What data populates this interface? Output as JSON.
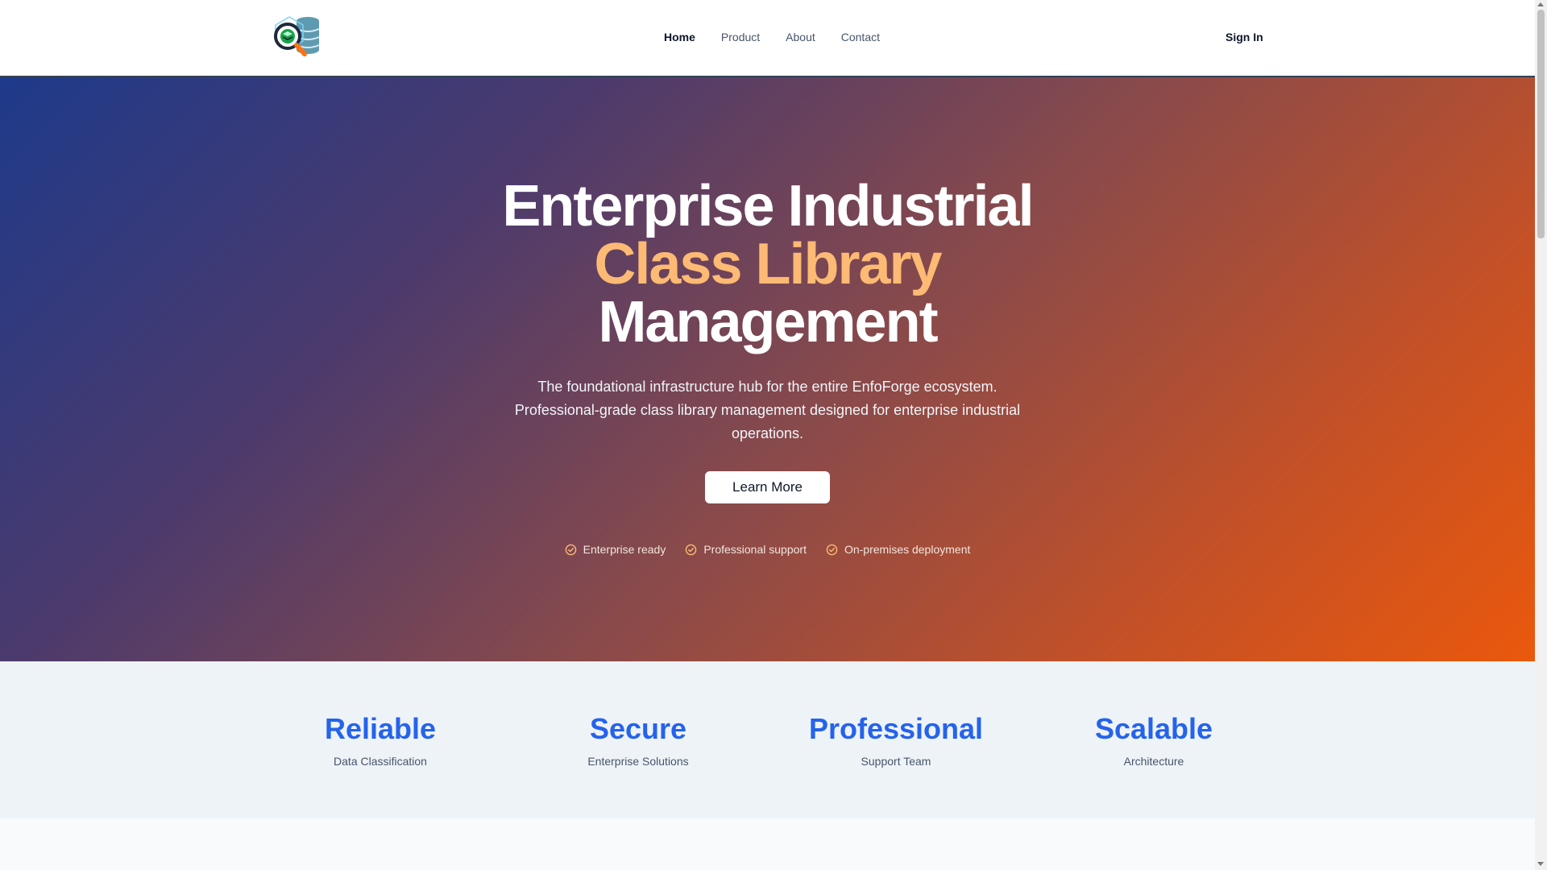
{
  "header": {
    "nav": [
      {
        "label": "Home"
      },
      {
        "label": "Product"
      },
      {
        "label": "About"
      },
      {
        "label": "Contact"
      }
    ],
    "signin_label": "Sign In"
  },
  "hero": {
    "title_line1": "Enterprise Industrial",
    "title_line2": "Class Library",
    "title_line3": "Management",
    "subtitle": "The foundational infrastructure hub for the entire EnfoForge ecosystem. Professional-grade class library management designed for enterprise industrial operations.",
    "cta_label": "Learn More",
    "features": [
      {
        "label": "Enterprise ready",
        "icon": "check-circle-icon"
      },
      {
        "label": "Professional support",
        "icon": "check-circle-icon"
      },
      {
        "label": "On-premises deployment",
        "icon": "check-circle-icon"
      }
    ]
  },
  "stats": [
    {
      "value": "Reliable",
      "label": "Data Classification"
    },
    {
      "value": "Secure",
      "label": "Enterprise Solutions"
    },
    {
      "value": "Professional",
      "label": "Support Team"
    },
    {
      "value": "Scalable",
      "label": "Architecture"
    }
  ],
  "colors": {
    "accent_blue": "#2563eb",
    "accent_orange": "#fdba74",
    "gradient_start": "#1e3a8a",
    "gradient_end": "#ea580c"
  }
}
